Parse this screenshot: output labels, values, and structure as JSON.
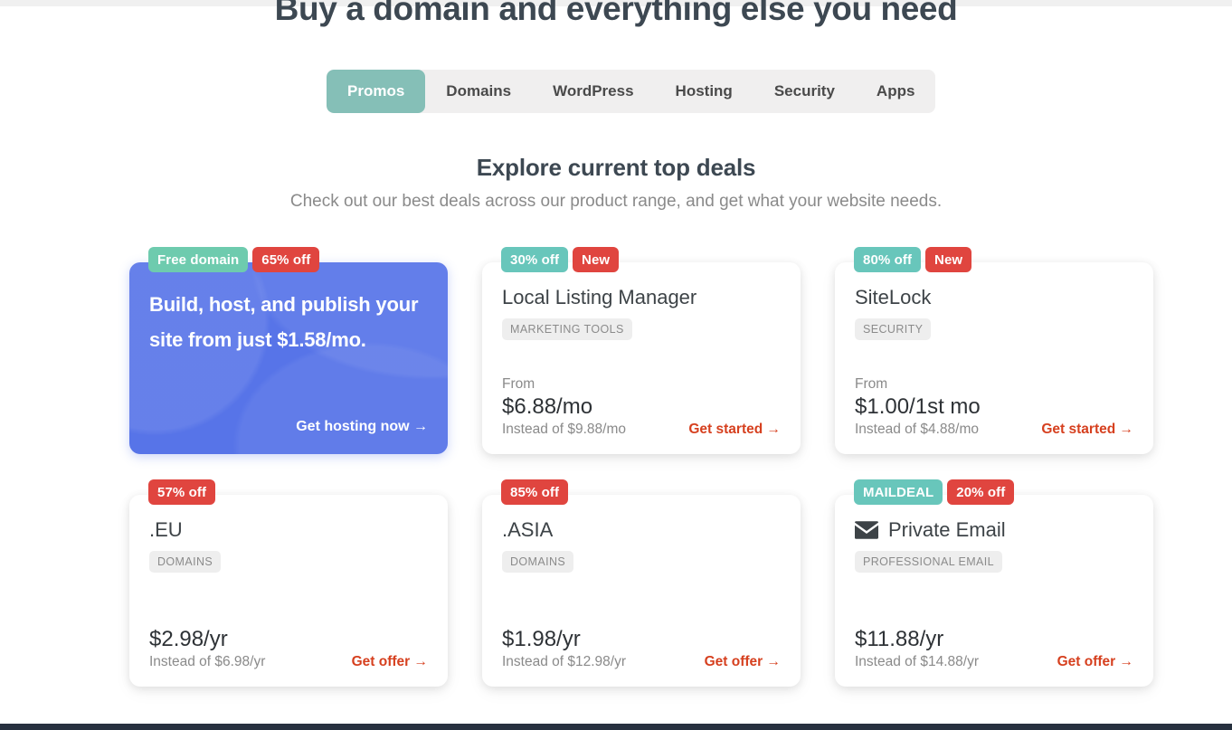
{
  "page": {
    "title": "Buy a domain and everything else you need"
  },
  "tabs": [
    {
      "label": "Promos",
      "active": true
    },
    {
      "label": "Domains",
      "active": false
    },
    {
      "label": "WordPress",
      "active": false
    },
    {
      "label": "Hosting",
      "active": false
    },
    {
      "label": "Security",
      "active": false
    },
    {
      "label": "Apps",
      "active": false
    }
  ],
  "section": {
    "title": "Explore current top deals",
    "subtitle": "Check out our best deals across our product range, and get what your website needs."
  },
  "colors": {
    "tab_active_bg": "#85bfb7",
    "tab_bar_bg": "#f0efef",
    "hero_card_bg": "#5774e8",
    "badge_teal": "#68c6bb",
    "badge_mint": "#6ecbae",
    "badge_red": "#e0453f",
    "link_red": "#d6401f",
    "bottom_bar": "#27313f"
  },
  "cards": [
    {
      "kind": "hero",
      "badges": [
        {
          "text": "Free domain",
          "style": "mint"
        },
        {
          "text": "65% off",
          "style": "red"
        }
      ],
      "headline": "Build, host, and publish your site from just $1.58/mo.",
      "cta": "Get hosting now →"
    },
    {
      "kind": "product",
      "badges": [
        {
          "text": "30% off",
          "style": "teal"
        },
        {
          "text": "New",
          "style": "red"
        }
      ],
      "title": "Local Listing Manager",
      "icon": null,
      "category": "MARKETING TOOLS",
      "from_label": "From",
      "price": "$6.88/mo",
      "instead": "Instead of $9.88/mo",
      "cta": "Get started →"
    },
    {
      "kind": "product",
      "badges": [
        {
          "text": "80% off",
          "style": "teal"
        },
        {
          "text": "New",
          "style": "red"
        }
      ],
      "title": "SiteLock",
      "icon": null,
      "category": "SECURITY",
      "from_label": "From",
      "price": "$1.00/1st mo",
      "instead": "Instead of $4.88/mo",
      "cta": "Get started →"
    },
    {
      "kind": "product",
      "badges": [
        {
          "text": "57% off",
          "style": "red"
        }
      ],
      "title": ".EU",
      "icon": null,
      "category": "DOMAINS",
      "from_label": "",
      "price": "$2.98/yr",
      "instead": "Instead of $6.98/yr",
      "cta": "Get offer →"
    },
    {
      "kind": "product",
      "badges": [
        {
          "text": "85% off",
          "style": "red"
        }
      ],
      "title": ".ASIA",
      "icon": null,
      "category": "DOMAINS",
      "from_label": "",
      "price": "$1.98/yr",
      "instead": "Instead of $12.98/yr",
      "cta": "Get offer →"
    },
    {
      "kind": "product",
      "badges": [
        {
          "text": "MAILDEAL",
          "style": "teal"
        },
        {
          "text": "20% off",
          "style": "red"
        }
      ],
      "title": "Private Email",
      "icon": "envelope-icon",
      "category": "PROFESSIONAL EMAIL",
      "from_label": "",
      "price": "$11.88/yr",
      "instead": "Instead of $14.88/yr",
      "cta": "Get offer →"
    }
  ]
}
